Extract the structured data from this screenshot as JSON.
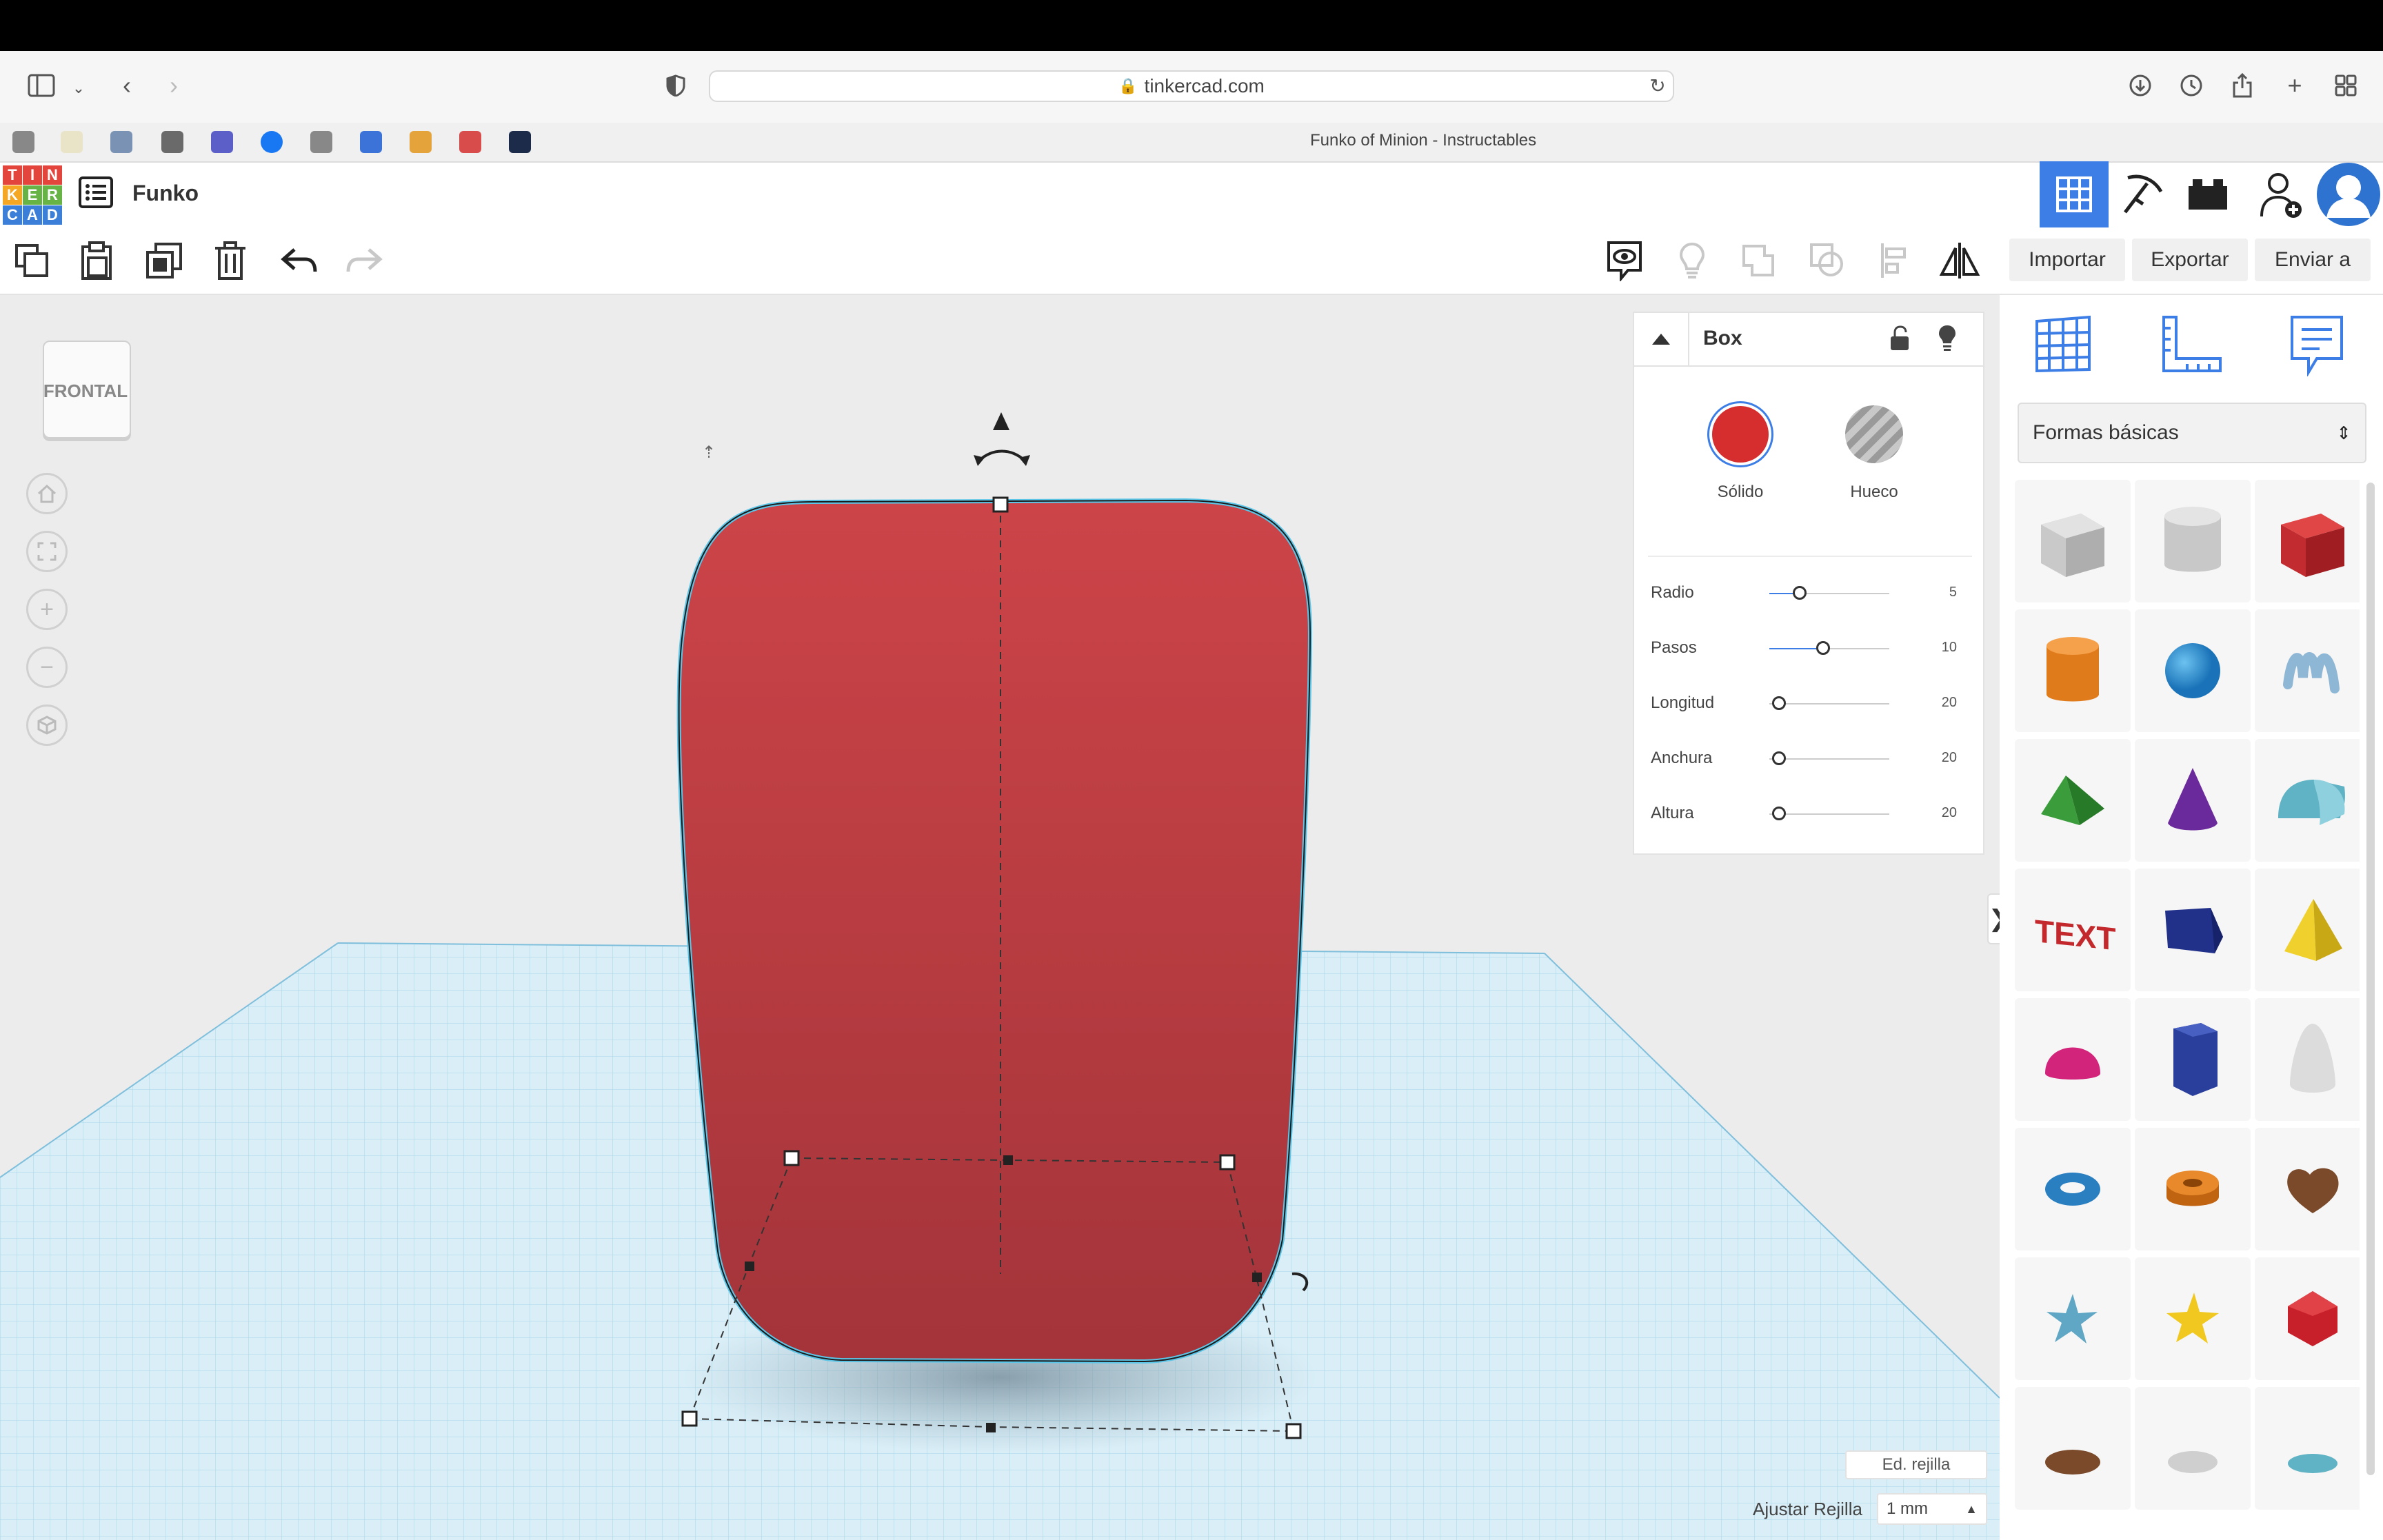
{
  "browser": {
    "url": "tinkercad.com",
    "tab_title": "Funko of Minion - Instructables"
  },
  "app": {
    "logo_letters": [
      "T",
      "I",
      "N",
      "K",
      "E",
      "R",
      "C",
      "A",
      "D"
    ],
    "project_name": "Funko",
    "buttons": {
      "import": "Importar",
      "export": "Exportar",
      "send": "Enviar a"
    }
  },
  "viewcube": {
    "label": "FRONTAL"
  },
  "inspector": {
    "title": "Box",
    "solid_label": "Sólido",
    "hole_label": "Hueco",
    "properties": [
      {
        "name": "Radio",
        "value": "5",
        "fill": 0.25
      },
      {
        "name": "Pasos",
        "value": "10",
        "fill": 0.45
      },
      {
        "name": "Longitud",
        "value": "20",
        "fill": 0.08
      },
      {
        "name": "Anchura",
        "value": "20",
        "fill": 0.08
      },
      {
        "name": "Altura",
        "value": "20",
        "fill": 0.08
      }
    ]
  },
  "shapes_panel": {
    "category": "Formas básicas"
  },
  "grid": {
    "edit_label": "Ed. rejilla",
    "snap_label": "Ajustar Rejilla",
    "snap_value": "1 mm"
  },
  "colors": {
    "accent": "#3d7ee6",
    "solid": "#d62e2e",
    "object": "#b53a3d",
    "grid": "#bfe3f2"
  }
}
